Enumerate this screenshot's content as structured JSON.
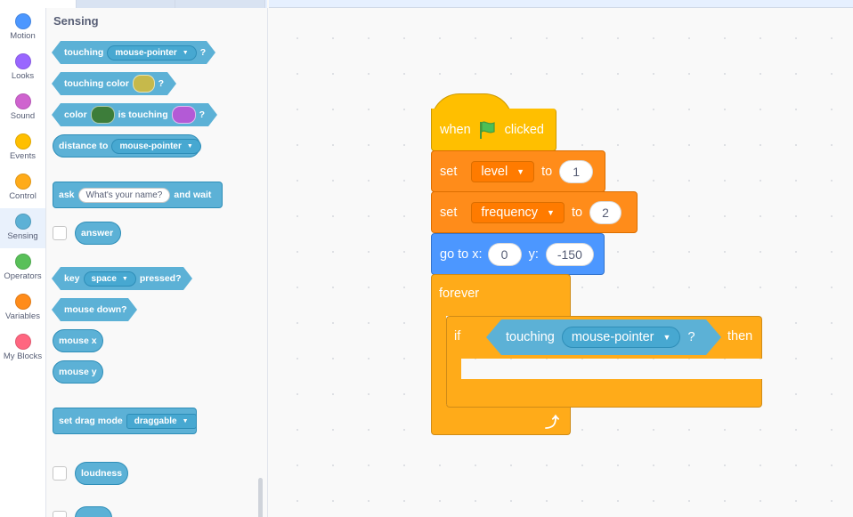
{
  "categories": [
    {
      "label": "Motion",
      "color": "#4c97ff"
    },
    {
      "label": "Looks",
      "color": "#9966ff"
    },
    {
      "label": "Sound",
      "color": "#cf63cf"
    },
    {
      "label": "Events",
      "color": "#ffbf00"
    },
    {
      "label": "Control",
      "color": "#ffab19"
    },
    {
      "label": "Sensing",
      "color": "#5cb1d6"
    },
    {
      "label": "Operators",
      "color": "#59c059"
    },
    {
      "label": "Variables",
      "color": "#ff8c1a"
    },
    {
      "label": "My Blocks",
      "color": "#ff6680"
    }
  ],
  "palette": {
    "title": "Sensing",
    "touching": {
      "label": "touching",
      "option": "mouse-pointer",
      "end": "?"
    },
    "touching_color": {
      "label": "touching color",
      "end": "?",
      "swatch": "#c6b94b"
    },
    "color_touching": {
      "label": "color",
      "mid": "is touching",
      "end": "?",
      "swatch1": "#3d7d3a",
      "swatch2": "#b35ad6"
    },
    "distance_to": {
      "label": "distance to",
      "option": "mouse-pointer"
    },
    "ask": {
      "label": "ask",
      "input": "What's your name?",
      "end": "and wait"
    },
    "answer": {
      "label": "answer"
    },
    "key_pressed": {
      "label": "key",
      "option": "space",
      "end": "pressed?"
    },
    "mouse_down": {
      "label": "mouse down?"
    },
    "mouse_x": {
      "label": "mouse x"
    },
    "mouse_y": {
      "label": "mouse y"
    },
    "drag_mode": {
      "label": "set drag mode",
      "option": "draggable"
    },
    "loudness": {
      "label": "loudness"
    }
  },
  "script": {
    "hat": {
      "pre": "when",
      "post": "clicked",
      "flag_color": "#4cbf56"
    },
    "set_level": {
      "label": "set",
      "var": "level",
      "to": "to",
      "value": "1"
    },
    "set_frequency": {
      "label": "set",
      "var": "frequency",
      "to": "to",
      "value": "2"
    },
    "goto": {
      "label": "go to x:",
      "x": "0",
      "ylabel": "y:",
      "y": "-150"
    },
    "forever": {
      "label": "forever",
      "loop_arrow": "⤴"
    },
    "if_block": {
      "label": "if",
      "then": "then"
    },
    "condition": {
      "label": "touching",
      "option": "mouse-pointer",
      "end": "?"
    }
  },
  "colors": {
    "motion": "#4c97ff",
    "events": "#ffbf00",
    "control": "#ffab19",
    "sensing": "#5cb1d6",
    "variables": "#ff8c1a"
  }
}
